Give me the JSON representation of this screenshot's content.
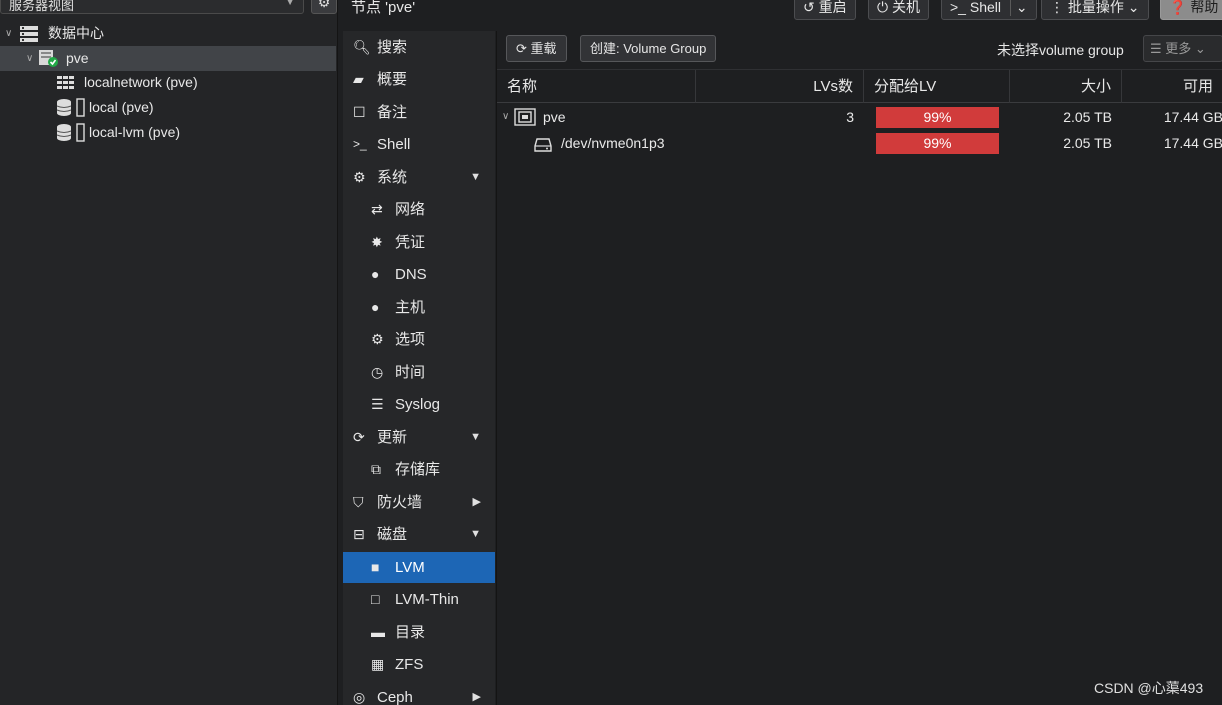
{
  "app": {
    "node_title": "节点 'pve'",
    "watermark": "CSDN @心蕖493"
  },
  "left_panel": {
    "view_select": "服务器视图",
    "tree": [
      {
        "label": "数据中心",
        "icon": "datacenter-icon"
      },
      {
        "label": "pve",
        "icon": "node-online-icon"
      },
      {
        "label": "localnetwork (pve)",
        "icon": "sdn-grid-icon"
      },
      {
        "label": "local (pve)",
        "icon": "storage-icon"
      },
      {
        "label": "local-lvm (pve)",
        "icon": "storage-icon"
      }
    ]
  },
  "toolbar": {
    "reboot": "重启",
    "shutdown": "关机",
    "shell": "Shell",
    "bulk": "批量操作",
    "help": "帮助"
  },
  "nav": [
    {
      "label": "搜索",
      "icon": "search-icon"
    },
    {
      "label": "概要",
      "icon": "book-icon"
    },
    {
      "label": "备注",
      "icon": "notes-icon"
    },
    {
      "label": "Shell",
      "icon": "terminal-icon"
    },
    {
      "label": "系统",
      "icon": "gears-icon",
      "expander": "▼"
    },
    {
      "label": "网络",
      "icon": "exchange-icon"
    },
    {
      "label": "凭证",
      "icon": "certificate-icon"
    },
    {
      "label": "DNS",
      "icon": "globe-icon"
    },
    {
      "label": "主机",
      "icon": "globe-icon"
    },
    {
      "label": "选项",
      "icon": "gear-icon"
    },
    {
      "label": "时间",
      "icon": "clock-icon"
    },
    {
      "label": "Syslog",
      "icon": "list-icon"
    },
    {
      "label": "更新",
      "icon": "refresh-icon",
      "expander": "▼"
    },
    {
      "label": "存储库",
      "icon": "files-icon"
    },
    {
      "label": "防火墙",
      "icon": "shield-icon",
      "expander": "▶"
    },
    {
      "label": "磁盘",
      "icon": "hdd-icon",
      "expander": "▼"
    },
    {
      "label": "LVM",
      "icon": "square-icon"
    },
    {
      "label": "LVM-Thin",
      "icon": "square-outline-icon"
    },
    {
      "label": "目录",
      "icon": "folder-icon"
    },
    {
      "label": "ZFS",
      "icon": "th-large-icon"
    },
    {
      "label": "Ceph",
      "icon": "ceph-icon",
      "expander": "▶"
    }
  ],
  "content": {
    "reload": "重载",
    "create": "创建: Volume Group",
    "no_selection": "未选择volume group",
    "more": "更多",
    "columns": {
      "name": "名称",
      "lvs": "LVs数",
      "assigned": "分配给LV",
      "size": "大小",
      "free": "可用"
    },
    "rows": [
      {
        "name": "pve",
        "lvs": "3",
        "assigned": "99%",
        "size": "2.05 TB",
        "free": "17.44 GB"
      },
      {
        "name": "/dev/nvme0n1p3",
        "lvs": "",
        "assigned": "99%",
        "size": "2.05 TB",
        "free": "17.44 GB"
      }
    ],
    "bar_color": "#d13b3b"
  }
}
